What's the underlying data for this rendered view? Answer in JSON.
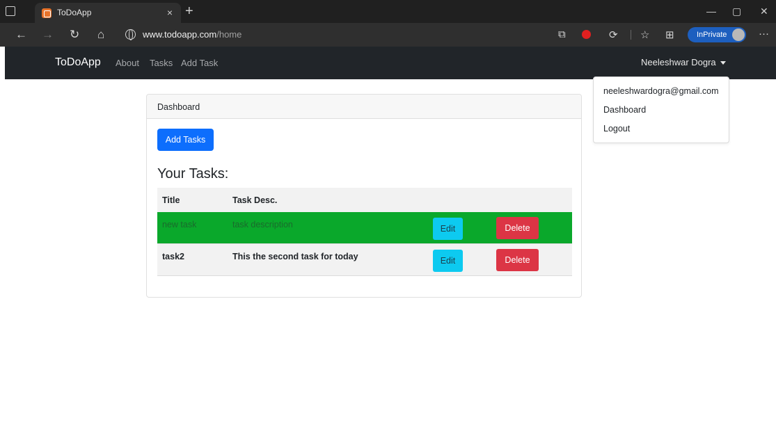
{
  "browser": {
    "tab_title": "ToDoApp",
    "tab_close": "×",
    "new_tab": "+",
    "url_domain": "www.todoapp.com",
    "url_path": "/home",
    "inprivate_label": "InPrivate",
    "back_icon": "←",
    "forward_icon": "→",
    "refresh_icon": "↻",
    "home_icon": "⌂",
    "minimize": "—",
    "maximize": "▢",
    "close": "✕",
    "more": "···",
    "favorites_icon": "☆",
    "collections_icon": "⊞",
    "extension_icon": "⟳",
    "split_icon": "⧉"
  },
  "navbar": {
    "brand": "ToDoApp",
    "links": [
      "About",
      "Tasks",
      "Add Task"
    ],
    "user_name": "Neeleshwar Dogra"
  },
  "dropdown": {
    "items": [
      "neeleshwardogra@gmail.com",
      "Dashboard",
      "Logout"
    ]
  },
  "card": {
    "header": "Dashboard",
    "add_button": "Add Tasks",
    "heading": "Your Tasks:",
    "columns": [
      "Title",
      "Task Desc."
    ],
    "rows": [
      {
        "title": "new task",
        "desc": "task description",
        "edit": "Edit",
        "delete": "Delete",
        "status_color": "#0aa82b"
      },
      {
        "title": "task2",
        "desc": "This the second task for today",
        "edit": "Edit",
        "delete": "Delete",
        "status_color": "#f2f2f2"
      }
    ]
  },
  "colors": {
    "primary": "#0d6efd",
    "info": "#0dcaf0",
    "danger": "#dc3545",
    "success": "#0aa82b",
    "navbar": "#212529"
  }
}
